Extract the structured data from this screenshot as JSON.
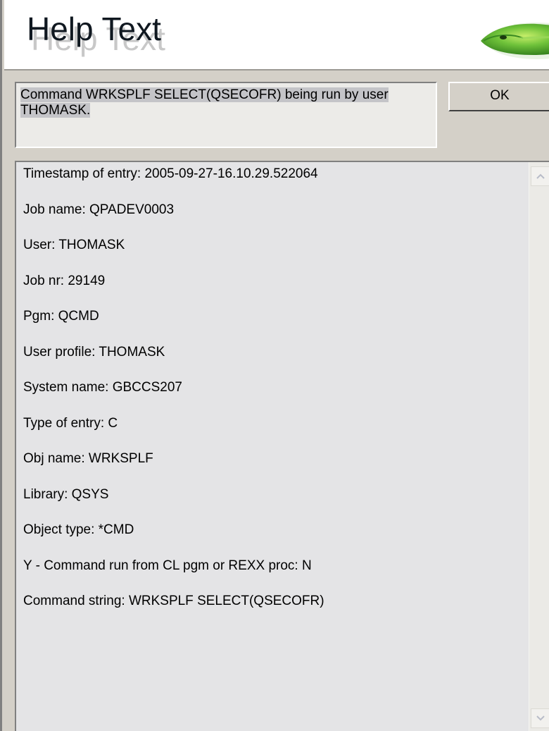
{
  "header": {
    "title": "Help Text",
    "logo_icon": "gecko-lizard-logo"
  },
  "message": {
    "text": "Command WRKSPLF SELECT(QSECOFR) being run by user THOMASK."
  },
  "buttons": {
    "ok_label": "OK"
  },
  "details": {
    "lines": [
      "Timestamp of entry: 2005-09-27-16.10.29.522064",
      "Job name: QPADEV0003",
      "User: THOMASK",
      "Job nr: 29149",
      "Pgm: QCMD",
      "User profile: THOMASK",
      "System name: GBCCS207",
      "Type of entry: C",
      "Obj name: WRKSPLF",
      "Library: QSYS",
      "Object type: *CMD",
      "Y - Command run from CL pgm or REXX proc: N",
      "Command string: WRKSPLF SELECT(QSECOFR)"
    ]
  },
  "scrollbar": {
    "up_icon": "scroll-up-arrow-icon",
    "down_icon": "scroll-down-arrow-icon"
  },
  "colors": {
    "window_bg": "#d4d0c8",
    "panel_bg": "#e4e4e6",
    "highlight": "#c4c4c8"
  }
}
